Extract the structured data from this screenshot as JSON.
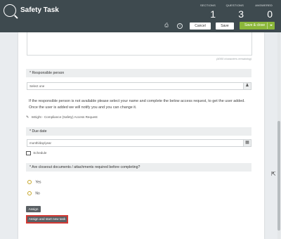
{
  "header": {
    "app_title": "Safety Task",
    "stats": {
      "sections_label": "SECTIONS",
      "sections_value": "1",
      "questions_label": "QUESTIONS",
      "questions_value": "3",
      "answered_label": "ANSWERED",
      "answered_value": "0"
    }
  },
  "toolbar": {
    "cancel_label": "Cancel",
    "save_label": "Save",
    "save_close_label": "Save & close",
    "icons": [
      "print-icon",
      "info-icon",
      "chevron-down-icon"
    ]
  },
  "form": {
    "char_remaining": "(4000 characters remaining)",
    "responsible": {
      "label": "* Responsible person",
      "select_value": "Select one",
      "note": "If the responsible person is not available please select your name and complete the below access request, to get the user added. Once the user is added we will notify you and you can change it.",
      "access_link": "InEight - Compliance (Safety) Access Request"
    },
    "due_date": {
      "label": "* Due date",
      "placeholder": "month/day/year",
      "schedule_label": "Schedule"
    },
    "closeout": {
      "label": "* Are closeout documents / attachments required before completing?",
      "options": [
        "Yes",
        "No"
      ]
    }
  },
  "actions": {
    "assign_label": "Assign",
    "assign_new_label": "Assign and start new task"
  },
  "colors": {
    "header_bg": "#3e4a4f",
    "accent_green": "#8bb73a",
    "highlight_red": "#d33a35",
    "radio_gold": "#c6a628"
  }
}
